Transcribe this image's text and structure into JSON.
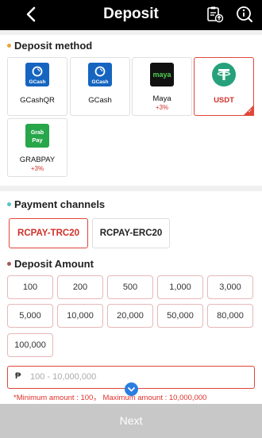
{
  "header": {
    "title": "Deposit",
    "back_icon": "back-chevron-icon",
    "icons": [
      "clipboard-history-icon",
      "info-circle-icon"
    ]
  },
  "deposit_method": {
    "title": "Deposit method",
    "methods": [
      {
        "name": "GCashQR",
        "logo_text": "GCash",
        "bonus": ""
      },
      {
        "name": "GCash",
        "logo_text": "GCash",
        "bonus": ""
      },
      {
        "name": "Maya",
        "logo_text": "maya",
        "bonus": "+3%"
      },
      {
        "name": "USDT",
        "logo_text": "",
        "bonus": ""
      },
      {
        "name": "GRABPAY",
        "logo_text_1": "Grab",
        "logo_text_2": "Pay",
        "bonus": "+3%"
      }
    ],
    "selected": "USDT"
  },
  "payment_channels": {
    "title": "Payment channels",
    "channels": [
      "RCPAY-TRC20",
      "RCPAY-ERC20"
    ],
    "selected": "RCPAY-TRC20"
  },
  "deposit_amount": {
    "title": "Deposit Amount",
    "chips": [
      "100",
      "200",
      "500",
      "1,000",
      "3,000",
      "5,000",
      "10,000",
      "20,000",
      "50,000",
      "80,000",
      "100,000"
    ],
    "input_currency": "₱",
    "input_placeholder": "100 - 10,000,000",
    "hint": "*Minimum amount : 100， Maximum amount : 10,000,000"
  },
  "footer": {
    "next_label": "Next"
  },
  "colors": {
    "accent": "#e0463a",
    "header_bg": "#000000",
    "gcash_blue": "#1565c0",
    "maya_bg": "#111111",
    "maya_green": "#4fcf4f",
    "usdt_green": "#26a17b",
    "grab_green": "#27a64a",
    "button_disabled": "#c8c8c8"
  }
}
